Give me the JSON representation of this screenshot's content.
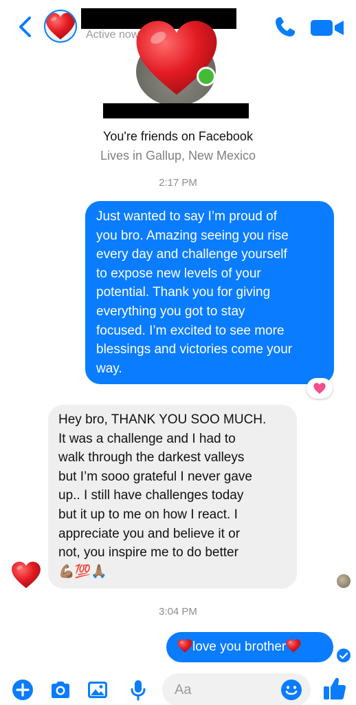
{
  "header": {
    "status": "Active now"
  },
  "profile": {
    "friends_text": "You're friends on Facebook",
    "lives_text": "Lives in Gallup, New Mexico"
  },
  "conversation": {
    "timestamp_1": "2:17 PM",
    "message_1_lines": [
      "Just wanted to say I’m proud of",
      "you bro. Amazing seeing you rise",
      "every day and challenge yourself",
      "to expose new levels of your",
      "potential. Thank you for giving",
      "everything you got to stay",
      "focused. I’m excited to see more",
      "blessings and victories come your",
      "way."
    ],
    "message_2_lines": [
      "Hey bro, THANK YOU SOO MUCH.",
      "It was a challenge and I had to",
      "walk through the darkest valleys",
      "but I’m sooo grateful I never gave",
      "up.. I still have challenges today",
      "but it up to me on how I react. I",
      "appreciate you and believe it or",
      "not, you inspire me to do better",
      "💪🏽💯🙏🏽"
    ],
    "timestamp_2": "3:04 PM",
    "message_3": "love you brother"
  },
  "composer": {
    "placeholder": "Aa"
  },
  "colors": {
    "accent": "#0a7cff",
    "incoming_bubble": "#efefef",
    "online": "#44bb37",
    "heart": "#e21b23"
  },
  "icons": {
    "back": "chevron-left-icon",
    "call": "phone-icon",
    "video": "video-camera-icon",
    "add": "plus-circle-icon",
    "camera": "camera-icon",
    "gallery": "image-icon",
    "mic": "microphone-icon",
    "emoji": "smiley-icon",
    "like": "thumbs-up-icon"
  }
}
